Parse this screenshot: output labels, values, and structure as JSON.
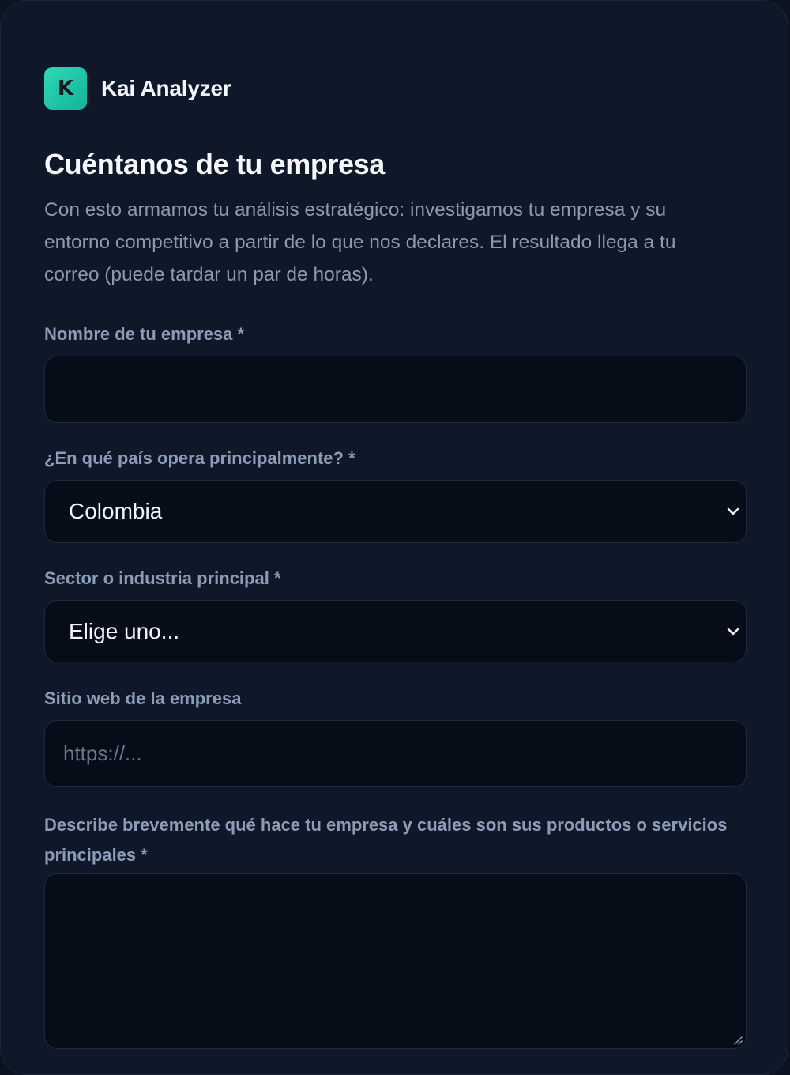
{
  "brand": {
    "logo_letter": "K",
    "name": "Kai Analyzer"
  },
  "page": {
    "title": "Cuéntanos de tu empresa",
    "intro": "Con esto armamos tu análisis estratégico: investigamos tu empresa y su entorno competitivo a partir de lo que nos declares. El resultado llega a tu correo (puede tardar un par de horas)."
  },
  "form": {
    "company_name": {
      "label": "Nombre de tu empresa *",
      "value": ""
    },
    "country": {
      "label": "¿En qué país opera principalmente? *",
      "selected": "Colombia"
    },
    "sector": {
      "label": "Sector o industria principal *",
      "selected": "Elige uno..."
    },
    "website": {
      "label": "Sitio web de la empresa",
      "placeholder": "https://..."
    },
    "description": {
      "label": "Describe brevemente qué hace tu empresa y cuáles son sus productos o servicios principales *",
      "value": ""
    }
  },
  "icons": {
    "select_arrow": "chevron-down-icon",
    "textarea_resize": "resize-grip-icon"
  },
  "colors": {
    "accent": "#2fd9b6",
    "background": "#0f1828",
    "field_background": "#070d18"
  }
}
